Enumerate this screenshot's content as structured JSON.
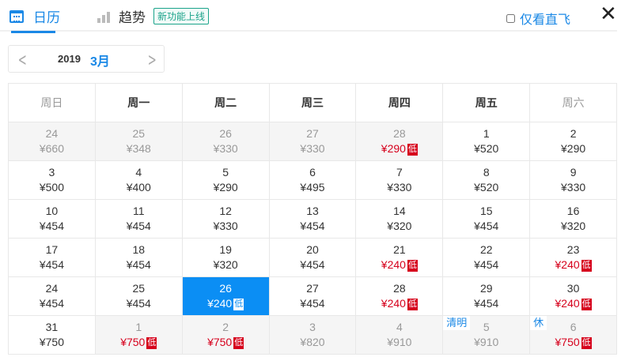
{
  "tabs": {
    "calendar": "日历",
    "trend": "趋势",
    "new_badge": "新功能上线"
  },
  "direct_only": "仅看直飞",
  "close": "✕",
  "nav": {
    "year": "2019",
    "month": "3月",
    "prev": "<",
    "next": ">"
  },
  "weekdays": [
    "周日",
    "周一",
    "周二",
    "周三",
    "周四",
    "周五",
    "周六"
  ],
  "low_badge": "低",
  "weeks": [
    [
      {
        "d": "24",
        "p": "¥660",
        "o": 1
      },
      {
        "d": "25",
        "p": "¥348",
        "o": 1
      },
      {
        "d": "26",
        "p": "¥330",
        "o": 1
      },
      {
        "d": "27",
        "p": "¥330",
        "o": 1
      },
      {
        "d": "28",
        "p": "¥290",
        "o": 1,
        "l": 1
      },
      {
        "d": "1",
        "p": "¥520"
      },
      {
        "d": "2",
        "p": "¥290"
      }
    ],
    [
      {
        "d": "3",
        "p": "¥500"
      },
      {
        "d": "4",
        "p": "¥400"
      },
      {
        "d": "5",
        "p": "¥290"
      },
      {
        "d": "6",
        "p": "¥495"
      },
      {
        "d": "7",
        "p": "¥330"
      },
      {
        "d": "8",
        "p": "¥520"
      },
      {
        "d": "9",
        "p": "¥330"
      }
    ],
    [
      {
        "d": "10",
        "p": "¥454"
      },
      {
        "d": "11",
        "p": "¥454"
      },
      {
        "d": "12",
        "p": "¥330"
      },
      {
        "d": "13",
        "p": "¥454"
      },
      {
        "d": "14",
        "p": "¥320"
      },
      {
        "d": "15",
        "p": "¥454"
      },
      {
        "d": "16",
        "p": "¥320"
      }
    ],
    [
      {
        "d": "17",
        "p": "¥454"
      },
      {
        "d": "18",
        "p": "¥454"
      },
      {
        "d": "19",
        "p": "¥320"
      },
      {
        "d": "20",
        "p": "¥454"
      },
      {
        "d": "21",
        "p": "¥240",
        "l": 1
      },
      {
        "d": "22",
        "p": "¥454"
      },
      {
        "d": "23",
        "p": "¥240",
        "l": 1
      }
    ],
    [
      {
        "d": "24",
        "p": "¥454"
      },
      {
        "d": "25",
        "p": "¥454"
      },
      {
        "d": "26",
        "p": "¥240",
        "l": 1,
        "s": 1
      },
      {
        "d": "27",
        "p": "¥454"
      },
      {
        "d": "28",
        "p": "¥240",
        "l": 1
      },
      {
        "d": "29",
        "p": "¥454"
      },
      {
        "d": "30",
        "p": "¥240",
        "l": 1
      }
    ],
    [
      {
        "d": "31",
        "p": "¥750"
      },
      {
        "d": "1",
        "p": "¥750",
        "o": 1,
        "l": 1
      },
      {
        "d": "2",
        "p": "¥750",
        "o": 1,
        "l": 1
      },
      {
        "d": "3",
        "p": "¥820",
        "o": 1
      },
      {
        "d": "4",
        "p": "¥910",
        "o": 1
      },
      {
        "d": "5",
        "p": "¥910",
        "o": 1,
        "t": "清明"
      },
      {
        "d": "6",
        "p": "¥750",
        "o": 1,
        "l": 1,
        "t": "休"
      }
    ]
  ]
}
